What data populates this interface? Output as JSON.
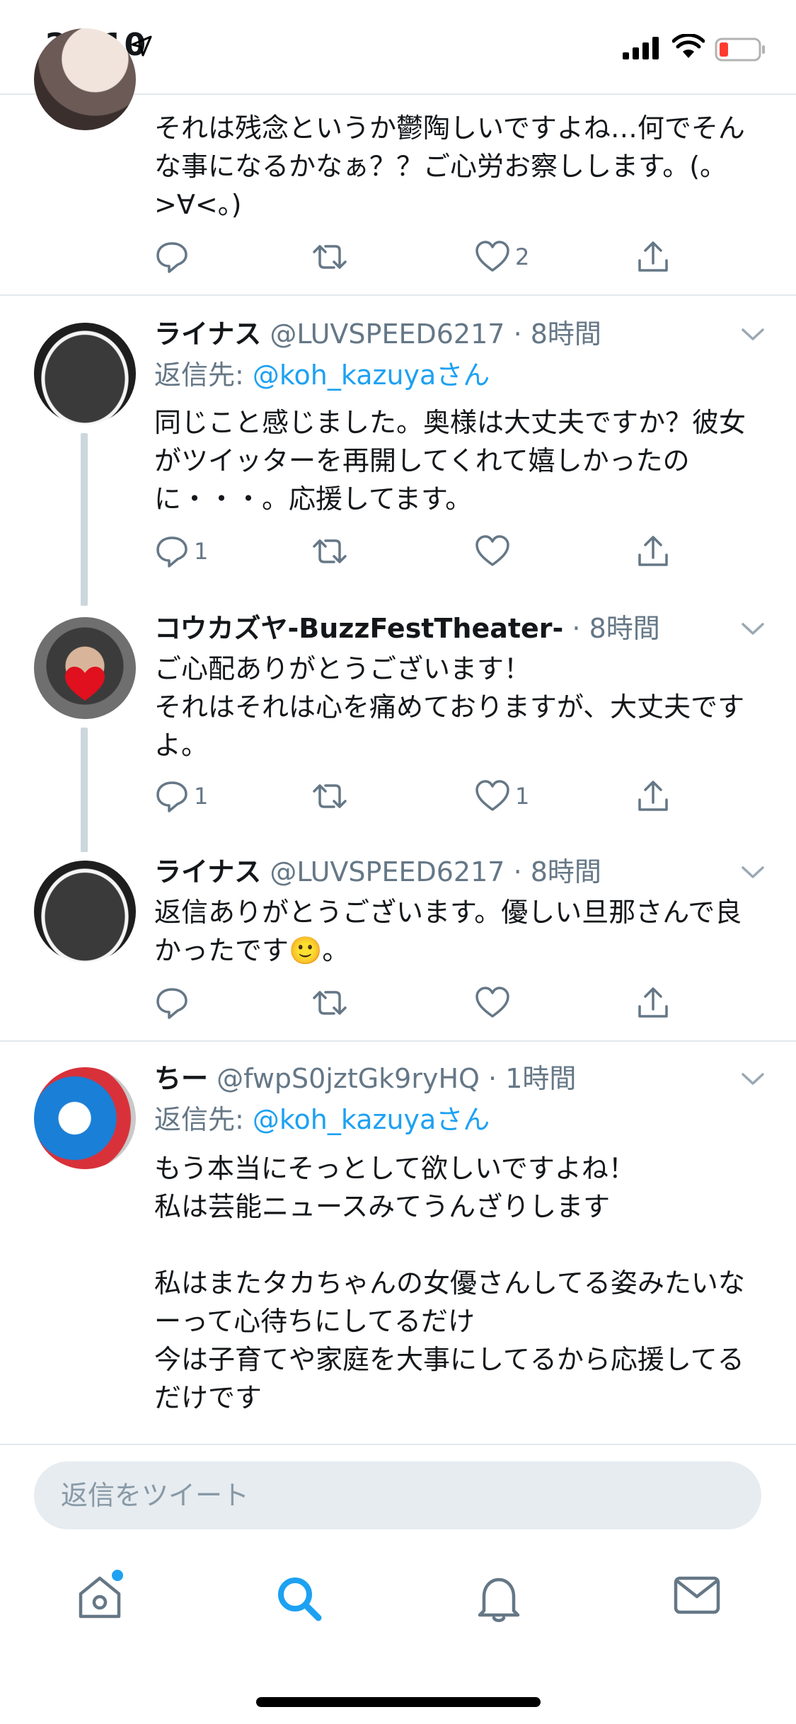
{
  "status_bar": {
    "time": "21:10"
  },
  "tweets": [
    {
      "body": "それは残念というか鬱陶しいですよね…何でそんな事になるかなぁ？？ご心労お察しします。(。>∀<。)",
      "reply_count": "",
      "retweet_count": "",
      "like_count": "2"
    },
    {
      "name": "ライナス",
      "handle": "@LUVSPEED6217",
      "time": "· 8時間",
      "reply_prefix": "返信先: ",
      "reply_mention": "@koh_kazuyaさん",
      "body": "同じこと感じました。奥様は大丈夫ですか？彼女がツイッターを再開してくれて嬉しかったのに・・・。応援してます。",
      "reply_count": "1",
      "like_count": ""
    },
    {
      "name": "コウカズヤ-BuzzFestTheater-",
      "time": "· 8時間",
      "body": "ご心配ありがとうございます！\nそれはそれは心を痛めておりますが、大丈夫ですよ。",
      "reply_count": "1",
      "like_count": "1"
    },
    {
      "name": "ライナス",
      "handle": "@LUVSPEED6217",
      "time": "· 8時間",
      "body": "返信ありがとうございます。優しい旦那さんで良かったです",
      "emoji": "🙂",
      "body_end": "。",
      "reply_count": "",
      "like_count": ""
    },
    {
      "name": "ちー",
      "handle": "@fwpS0jztGk9ryHQ",
      "time": "· 1時間",
      "reply_prefix": "返信先: ",
      "reply_mention": "@koh_kazuyaさん",
      "body": "もう本当にそっとして欲しいですよね！\n私は芸能ニュースみてうんざりします\n\n私はまたタカちゃんの女優さんしてる姿みたいなーって心待ちにしてるだけ\n今は子育てや家庭を大事にしてるから応援してるだけです"
    }
  ],
  "reply_box": {
    "placeholder": "返信をツイート"
  },
  "tabs": [
    "home-icon",
    "search-icon",
    "notifications-icon",
    "messages-icon"
  ],
  "colors": {
    "accent": "#1da1f2",
    "muted": "#657786",
    "separator": "#e1e8ed"
  }
}
